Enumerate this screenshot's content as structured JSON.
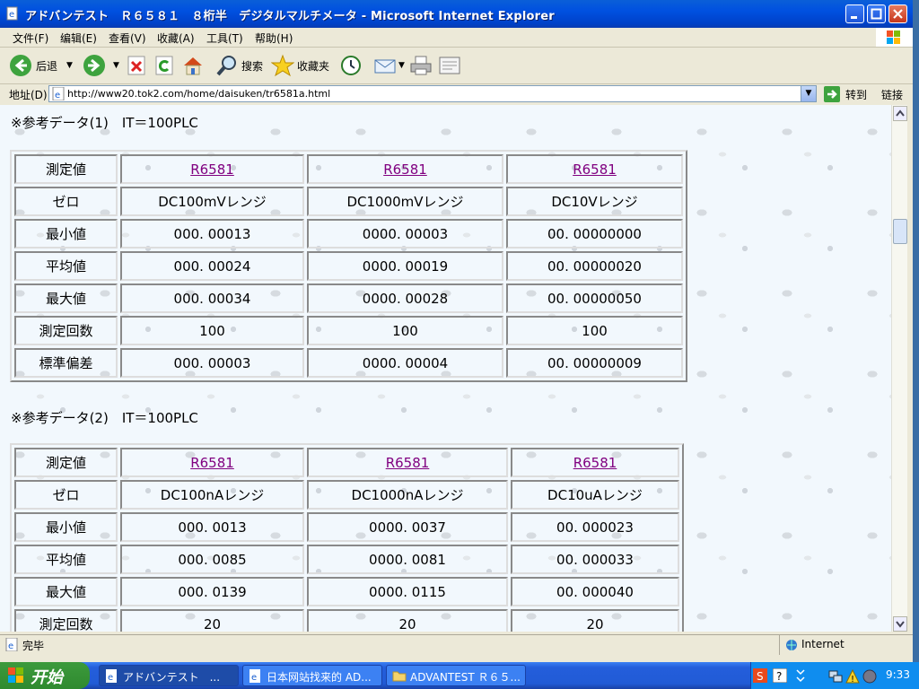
{
  "window": {
    "title": "アドバンテスト　Ｒ６５８１　８桁半　デジタルマルチメータ - Microsoft Internet Explorer"
  },
  "menu": [
    "文件(F)",
    "编辑(E)",
    "查看(V)",
    "收藏(A)",
    "工具(T)",
    "帮助(H)"
  ],
  "toolbar": {
    "back_label": "后退",
    "search_label": "搜索",
    "favorites_label": "收藏夹"
  },
  "address": {
    "label": "地址(D)",
    "url": "http://www20.tok2.com/home/daisuken/tr6581a.html",
    "go_label": "转到",
    "links_label": "链接"
  },
  "tables": [
    {
      "heading": "※参考データ(1)　IT＝100PLC",
      "rows": [
        {
          "label": "測定値",
          "cells": [
            "R6581",
            "R6581",
            "R6581"
          ]
        },
        {
          "label": "ゼロ",
          "cells": [
            "DC100mVレンジ",
            "DC1000mVレンジ",
            "DC10Vレンジ"
          ]
        },
        {
          "label": "最小値",
          "cells": [
            "000. 00013",
            "0000. 00003",
            "00. 00000000"
          ]
        },
        {
          "label": "平均値",
          "cells": [
            "000. 00024",
            "0000. 00019",
            "00. 00000020"
          ]
        },
        {
          "label": "最大値",
          "cells": [
            "000. 00034",
            "0000. 00028",
            "00. 00000050"
          ]
        },
        {
          "label": "測定回数",
          "cells": [
            "100",
            "100",
            "100"
          ]
        },
        {
          "label": "標準偏差",
          "cells": [
            "000. 00003",
            "0000. 00004",
            "00. 00000009"
          ]
        }
      ]
    },
    {
      "heading": "※参考データ(2)　IT＝100PLC",
      "rows": [
        {
          "label": "測定値",
          "cells": [
            "R6581",
            "R6581",
            "R6581"
          ]
        },
        {
          "label": "ゼロ",
          "cells": [
            "DC100nAレンジ",
            "DC1000nAレンジ",
            "DC10uAレンジ"
          ]
        },
        {
          "label": "最小値",
          "cells": [
            "000. 0013",
            "0000. 0037",
            "00. 000023"
          ]
        },
        {
          "label": "平均値",
          "cells": [
            "000. 0085",
            "0000. 0081",
            "00. 000033"
          ]
        },
        {
          "label": "最大値",
          "cells": [
            "000. 0139",
            "0000. 0115",
            "00. 000040"
          ]
        },
        {
          "label": "測定回数",
          "cells": [
            "20",
            "20",
            "20"
          ]
        }
      ]
    }
  ],
  "status": {
    "text": "完毕",
    "zone": "Internet"
  },
  "taskbar": {
    "start_label": "开始",
    "tasks": [
      "アドバンテスト　...",
      "日本网站找来的 AD...",
      "ADVANTEST Ｒ６５..."
    ],
    "clock": "9:33"
  }
}
